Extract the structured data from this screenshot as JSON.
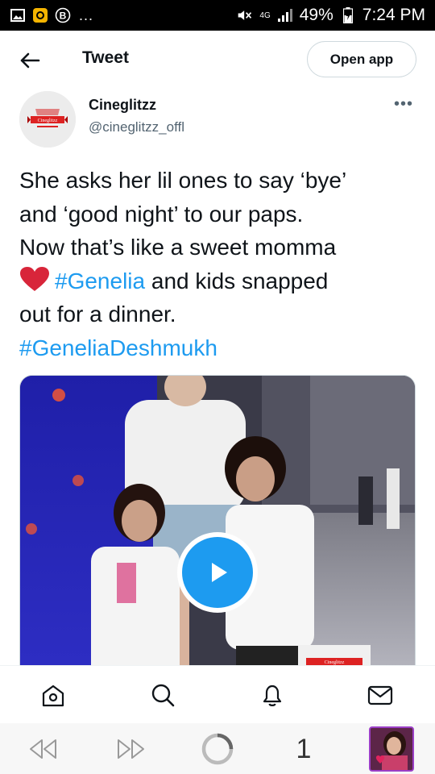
{
  "status_bar": {
    "network_type": "4G",
    "battery": "49%",
    "time": "7:24 PM",
    "dots": "..."
  },
  "header": {
    "title": "Tweet",
    "open_app_label": "Open app"
  },
  "author": {
    "name": "Cineglitzz",
    "handle": "@cineglitzz_offl",
    "logo_text": "Cineglitzz"
  },
  "more_label": "•••",
  "tweet": {
    "line1": "She asks her lil ones to say ‘bye’",
    "line2": "and ‘good night’ to our paps.",
    "line3": "Now that’s like a sweet momma",
    "hashtag1": "#Genelia",
    "after_hashtag1": " and kids snapped",
    "line5": "out for a dinner.",
    "hashtag2": "#GeneliaDeshmukh"
  },
  "media": {
    "type": "video",
    "watermark_text": "Cineglitzz"
  },
  "bottom_nav": [
    "home-icon",
    "search-icon",
    "notifications-icon",
    "messages-icon"
  ],
  "browser_bar": {
    "tab_count": "1"
  },
  "colors": {
    "accent": "#1d9bf0",
    "heart": "#e0245e",
    "text": "#0f1419",
    "muted": "#536471"
  }
}
